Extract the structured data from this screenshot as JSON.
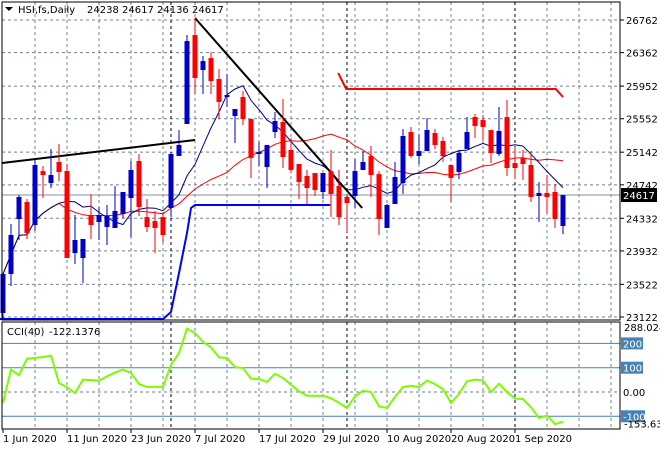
{
  "header": {
    "symbol_label": "HSI,fs,Daily",
    "ohlc_text": "24238 24617 24136 24617"
  },
  "indicator": {
    "label": "CCI(40)",
    "value_text": "-122.1376",
    "max_label": "288.024",
    "min_label": "-153.635",
    "level_labels": [
      "200",
      "100",
      "0.00",
      "-100"
    ]
  },
  "current_price_label": "24617",
  "colors": {
    "bull": "#0000c8",
    "bear": "#ff0000",
    "ma_fast": "#000080",
    "ma_slow": "#ff0000",
    "cci": "#7cfc00",
    "level": "#4682b4",
    "grid": "#708090",
    "trendline": "#000000",
    "support": "#0000ff",
    "resistance": "#ff0000"
  },
  "chart_data": [
    {
      "type": "candlestick",
      "title": "HSI,fs,Daily",
      "ylim": [
        23122,
        26762
      ],
      "yticks": [
        "26762",
        "26362",
        "25952",
        "25552",
        "25142",
        "24742",
        "24332",
        "23932",
        "23522",
        "23122"
      ],
      "xtick_labels": [
        "1 Jun 2020",
        "11 Jun 2020",
        "23 Jun 2020",
        "7 Jul 2020",
        "17 Jul 2020",
        "29 Jul 2020",
        "10 Aug 2020",
        "20 Aug 2020",
        "1 Sep 2020"
      ],
      "xtick_every": 8,
      "period_separators": [
        21,
        43,
        64
      ],
      "ohlc": [
        [
          23171,
          23649,
          23085,
          23649
        ],
        [
          23649,
          24262,
          23502,
          24127
        ],
        [
          24323,
          24617,
          24066,
          24593
        ],
        [
          24531,
          24568,
          24078,
          24151
        ],
        [
          24249,
          25058,
          24176,
          24985
        ],
        [
          24911,
          24973,
          24580,
          24862
        ],
        [
          24764,
          25181,
          24703,
          24862
        ],
        [
          25022,
          25242,
          24789,
          24899
        ],
        [
          24911,
          24997,
          23845,
          23845
        ],
        [
          23906,
          24372,
          23771,
          24066
        ],
        [
          23845,
          24078,
          23539,
          24078
        ],
        [
          24372,
          24629,
          24078,
          24249
        ],
        [
          24286,
          24470,
          24066,
          24372
        ],
        [
          24225,
          24495,
          24004,
          24360
        ],
        [
          24213,
          24727,
          24213,
          24421
        ],
        [
          24384,
          24654,
          24335,
          24654
        ],
        [
          24580,
          25034,
          24102,
          24924
        ],
        [
          25034,
          25120,
          24360,
          24470
        ],
        [
          24347,
          24568,
          24164,
          24225
        ],
        [
          24298,
          24421,
          23906,
          24213
        ],
        [
          24347,
          24409,
          24041,
          24127
        ],
        [
          24458,
          25120,
          24347,
          25120
        ],
        [
          25095,
          25414,
          25095,
          25230
        ],
        [
          25487,
          26578,
          25487,
          26504
        ],
        [
          26578,
          26786,
          25855,
          26051
        ],
        [
          26149,
          26321,
          25855,
          26259
        ],
        [
          26296,
          26370,
          25855,
          26014
        ],
        [
          26039,
          26161,
          25549,
          25757
        ],
        [
          25818,
          26100,
          25696,
          25843
        ],
        [
          25585,
          25671,
          25254,
          25671
        ],
        [
          25818,
          25892,
          25475,
          25549
        ],
        [
          25549,
          25549,
          24826,
          25071
        ],
        [
          25120,
          25267,
          24973,
          25144
        ],
        [
          24960,
          25230,
          24703,
          25230
        ],
        [
          25389,
          25634,
          25316,
          25524
        ],
        [
          25512,
          25794,
          24948,
          25083
        ],
        [
          25169,
          25316,
          24887,
          24924
        ],
        [
          24997,
          24997,
          24568,
          24776
        ],
        [
          24850,
          24924,
          24507,
          24703
        ],
        [
          24887,
          24887,
          24605,
          24678
        ],
        [
          24654,
          24887,
          24568,
          24887
        ],
        [
          24911,
          25169,
          24347,
          24629
        ],
        [
          24727,
          24924,
          24249,
          24347
        ],
        [
          24593,
          24593,
          24164,
          24519
        ],
        [
          24605,
          25058,
          24458,
          24911
        ],
        [
          24924,
          25156,
          24924,
          25022
        ],
        [
          25095,
          25218,
          24593,
          24862
        ],
        [
          24874,
          24911,
          24127,
          24323
        ],
        [
          24213,
          24507,
          24213,
          24495
        ],
        [
          24507,
          25022,
          24507,
          24838
        ],
        [
          24764,
          25426,
          24629,
          25340
        ],
        [
          25389,
          25451,
          25071,
          25095
        ],
        [
          25095,
          25365,
          24997,
          25156
        ],
        [
          25156,
          25561,
          25156,
          25414
        ],
        [
          25377,
          25426,
          25181,
          25230
        ],
        [
          25279,
          25328,
          25022,
          25095
        ],
        [
          24985,
          24985,
          24531,
          24826
        ],
        [
          24899,
          25169,
          24813,
          25132
        ],
        [
          25181,
          25573,
          25181,
          25389
        ],
        [
          25573,
          25610,
          25316,
          25463
        ],
        [
          25536,
          25597,
          25291,
          25451
        ],
        [
          25414,
          25414,
          25009,
          25132
        ],
        [
          25120,
          25696,
          25095,
          25402
        ],
        [
          25573,
          25781,
          24850,
          24948
        ],
        [
          25009,
          25205,
          24813,
          24948
        ],
        [
          25071,
          25169,
          24801,
          24997
        ],
        [
          24985,
          25156,
          24531,
          24593
        ],
        [
          24605,
          24776,
          24286,
          24642
        ],
        [
          24642,
          24862,
          24397,
          24593
        ],
        [
          24654,
          24752,
          24213,
          24323
        ],
        [
          24238,
          24617,
          24136,
          24617
        ]
      ],
      "ma_periods": {
        "fast": 8,
        "slow": 21
      },
      "trendlines": [
        {
          "name": "rising-trendline",
          "points": [
            [
              -0.1,
              25009
            ],
            [
              24,
              25291
            ]
          ]
        },
        {
          "name": "falling-trendline",
          "points": [
            [
              24,
              26786
            ],
            [
              44.9,
              24458
            ]
          ]
        }
      ],
      "support_line": [
        [
          -0.5,
          23098
        ],
        [
          20,
          23098
        ],
        [
          21,
          23183
        ],
        [
          22,
          23661
        ],
        [
          23,
          24151
        ],
        [
          23.5,
          24458
        ],
        [
          24,
          24495
        ],
        [
          40.9,
          24495
        ]
      ],
      "resistance_line": [
        [
          41.9,
          26112
        ],
        [
          42.9,
          25916
        ],
        [
          69.1,
          25916
        ],
        [
          70,
          25818
        ]
      ],
      "current_price": 24617
    },
    {
      "type": "line",
      "title": "CCI(40)",
      "ylim": [
        -153.635,
        288.024
      ],
      "levels": [
        200,
        100,
        0,
        -100
      ],
      "values": [
        -45,
        92,
        69,
        137,
        140,
        144,
        150,
        37,
        20,
        -4,
        51,
        49,
        47,
        64,
        80,
        92,
        78,
        33,
        21,
        21,
        21,
        112,
        160,
        261,
        243,
        206,
        184,
        143,
        140,
        102,
        99,
        55,
        53,
        41,
        75,
        58,
        30,
        3,
        -15,
        -16,
        -16,
        -25,
        -45,
        -66,
        -18,
        5,
        0,
        -59,
        -66,
        -20,
        21,
        26,
        21,
        47,
        33,
        12,
        -45,
        -8,
        44,
        51,
        48,
        0,
        34,
        0,
        -27,
        -29,
        -63,
        -107,
        -97,
        -132,
        -122.1376
      ]
    }
  ]
}
